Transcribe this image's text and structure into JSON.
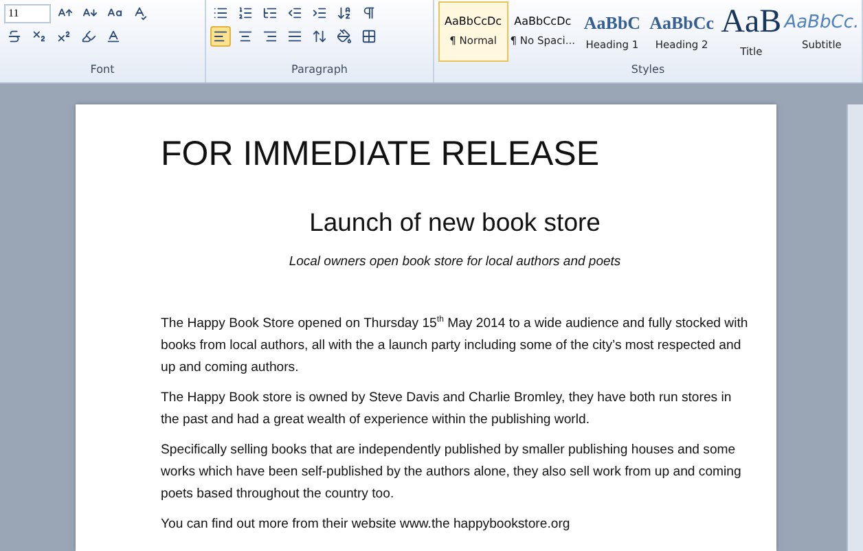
{
  "ribbon": {
    "font_size": "11",
    "align_buttons": [
      {
        "kind": "left",
        "selected": true
      },
      {
        "kind": "center",
        "selected": false
      },
      {
        "kind": "right",
        "selected": false
      },
      {
        "kind": "justify",
        "selected": false
      }
    ],
    "groups": [
      "Font",
      "Paragraph",
      "Styles"
    ],
    "styles": [
      {
        "preview": "AaBbCcDc",
        "name": "¶ Normal",
        "kind": "normal",
        "selected": true
      },
      {
        "preview": "AaBbCcDc",
        "name": "¶ No Spaci...",
        "kind": "normal",
        "selected": false
      },
      {
        "preview": "AaBbC",
        "name": "Heading 1",
        "kind": "heading1",
        "selected": false
      },
      {
        "preview": "AaBbCc",
        "name": "Heading 2",
        "kind": "heading2",
        "selected": false
      },
      {
        "preview": "AaB",
        "name": "Title",
        "kind": "title",
        "selected": false
      },
      {
        "preview": "AaBbCc.",
        "name": "Subtitle",
        "kind": "subtitle",
        "selected": false
      }
    ]
  },
  "document": {
    "heading": "FOR IMMEDIATE RELEASE",
    "title": "Launch of new book store",
    "subtitle": "Local owners open book store for local authors and poets",
    "paragraphs": [
      "The Happy Book Store opened on Thursday 15$^{th}$ May 2014  to a wide audience and fully stocked with books from local authors, all with the a launch party including some of the city’s most respected and up and coming authors.",
      "The Happy Book store is owned by Steve Davis and Charlie Bromley, they have both run stores in the past and had a great wealth of experience within the publishing world.",
      "Specifically selling books that are independently published by smaller publishing houses and some works which have been self-published by the authors alone, they also sell work from up and coming poets based throughout the country too.",
      "You can find out more from their website www.the happybookstore.org"
    ]
  }
}
